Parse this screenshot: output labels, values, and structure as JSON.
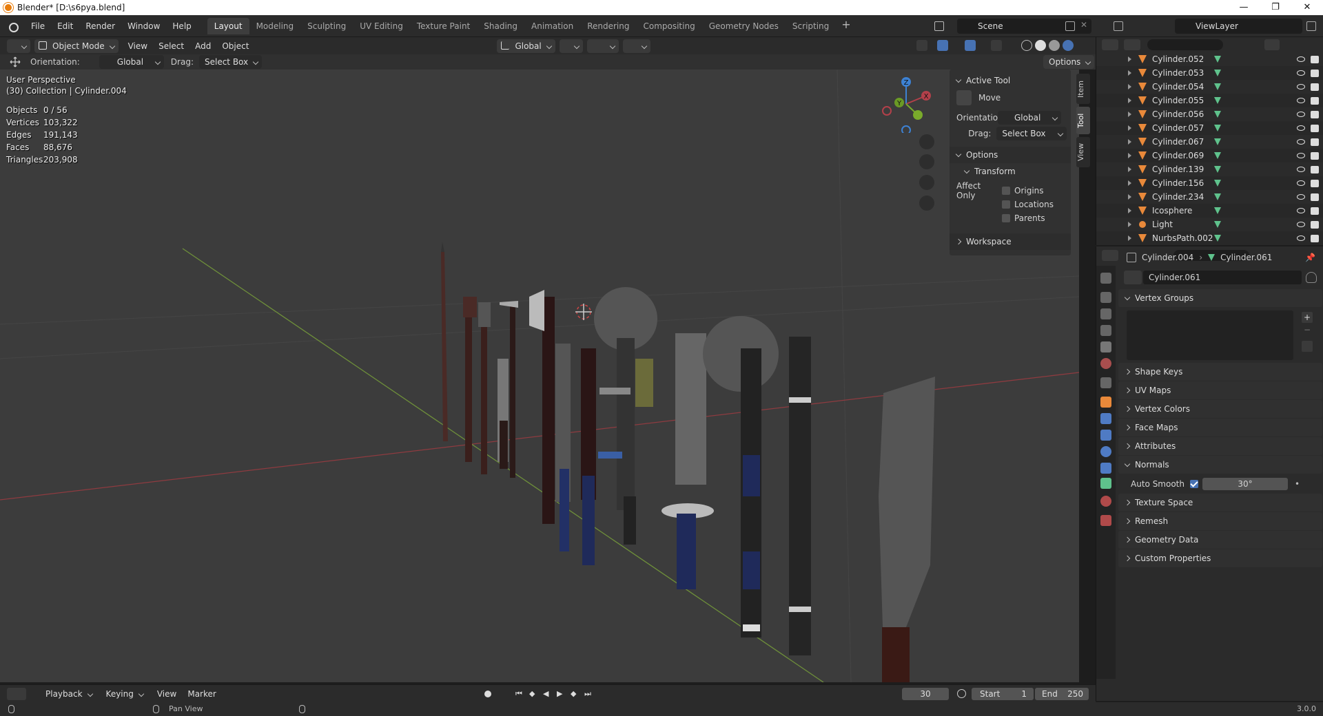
{
  "window": {
    "title": "Blender* [D:\\s6pya.blend]",
    "controls": [
      "—",
      "❐",
      "✕"
    ]
  },
  "menubar": {
    "items": [
      "File",
      "Edit",
      "Render",
      "Window",
      "Help"
    ]
  },
  "workspaces": {
    "tabs": [
      "Layout",
      "Modeling",
      "Sculpting",
      "UV Editing",
      "Texture Paint",
      "Shading",
      "Animation",
      "Rendering",
      "Compositing",
      "Geometry Nodes",
      "Scripting"
    ],
    "active": "Layout",
    "add": "+"
  },
  "scene": {
    "name": "Scene"
  },
  "view_layer": {
    "name": "ViewLayer"
  },
  "viewport_header": {
    "mode": "Object Mode",
    "menus": [
      "View",
      "Select",
      "Add",
      "Object"
    ],
    "transform_orientation": "Global"
  },
  "tool_settings": {
    "orientation_label": "Orientation:",
    "orientation_value": "Global",
    "drag_label": "Drag:",
    "drag_value": "Select Box",
    "options_label": "Options"
  },
  "viewport_overlay": {
    "perspective": "User Perspective",
    "collection_line": "(30) Collection | Cylinder.004",
    "stats": [
      {
        "label": "Objects",
        "value": "0 / 56"
      },
      {
        "label": "Vertices",
        "value": "103,322"
      },
      {
        "label": "Edges",
        "value": "191,143"
      },
      {
        "label": "Faces",
        "value": "88,676"
      },
      {
        "label": "Triangles",
        "value": "203,908"
      }
    ]
  },
  "gizmo": {
    "z": "Z",
    "x": "X",
    "y": "Y"
  },
  "npanel": {
    "tabs": [
      "Item",
      "Tool",
      "View"
    ],
    "active_tab": "Tool",
    "active_tool_header": "Active Tool",
    "tool_name": "Move",
    "orientation_label": "Orientation",
    "orientation_value": "Global",
    "drag_label": "Drag:",
    "drag_value": "Select Box",
    "options_header": "Options",
    "transform_header": "Transform",
    "affect_only_label": "Affect Only",
    "affect_only": [
      {
        "label": "Origins",
        "checked": false
      },
      {
        "label": "Locations",
        "checked": false
      },
      {
        "label": "Parents",
        "checked": false
      }
    ],
    "workspace_header": "Workspace"
  },
  "outliner": {
    "rows": [
      {
        "name": "Cylinder.052",
        "type": "mesh"
      },
      {
        "name": "Cylinder.053",
        "type": "mesh"
      },
      {
        "name": "Cylinder.054",
        "type": "mesh"
      },
      {
        "name": "Cylinder.055",
        "type": "mesh"
      },
      {
        "name": "Cylinder.056",
        "type": "mesh"
      },
      {
        "name": "Cylinder.057",
        "type": "mesh"
      },
      {
        "name": "Cylinder.067",
        "type": "mesh"
      },
      {
        "name": "Cylinder.069",
        "type": "mesh"
      },
      {
        "name": "Cylinder.139",
        "type": "mesh"
      },
      {
        "name": "Cylinder.156",
        "type": "mesh"
      },
      {
        "name": "Cylinder.234",
        "type": "mesh"
      },
      {
        "name": "Icosphere",
        "type": "mesh"
      },
      {
        "name": "Light",
        "type": "light"
      },
      {
        "name": "NurbsPath.002",
        "type": "mesh"
      }
    ]
  },
  "properties": {
    "breadcrumb_object": "Cylinder.004",
    "breadcrumb_data": "Cylinder.061",
    "data_name": "Cylinder.061",
    "vertex_groups_header": "Vertex Groups",
    "sections": [
      "Shape Keys",
      "UV Maps",
      "Vertex Colors",
      "Face Maps",
      "Attributes"
    ],
    "normals_header": "Normals",
    "auto_smooth_label": "Auto Smooth",
    "auto_smooth_checked": true,
    "auto_smooth_angle": "30°",
    "sections_after": [
      "Texture Space",
      "Remesh",
      "Geometry Data",
      "Custom Properties"
    ]
  },
  "timeline": {
    "menus": [
      "Playback",
      "Keying",
      "View",
      "Marker"
    ],
    "current_frame": "30",
    "start_label": "Start",
    "start_value": "1",
    "end_label": "End",
    "end_value": "250"
  },
  "statusbar": {
    "hint": "Pan View",
    "version": "3.0.0"
  },
  "colors": {
    "accent_blue": "#4772b3",
    "object_orange": "#e9893a",
    "data_green": "#5fc28c",
    "axis_x": "#b3404a",
    "axis_y": "#7aab2b",
    "axis_z": "#3d82d4"
  }
}
